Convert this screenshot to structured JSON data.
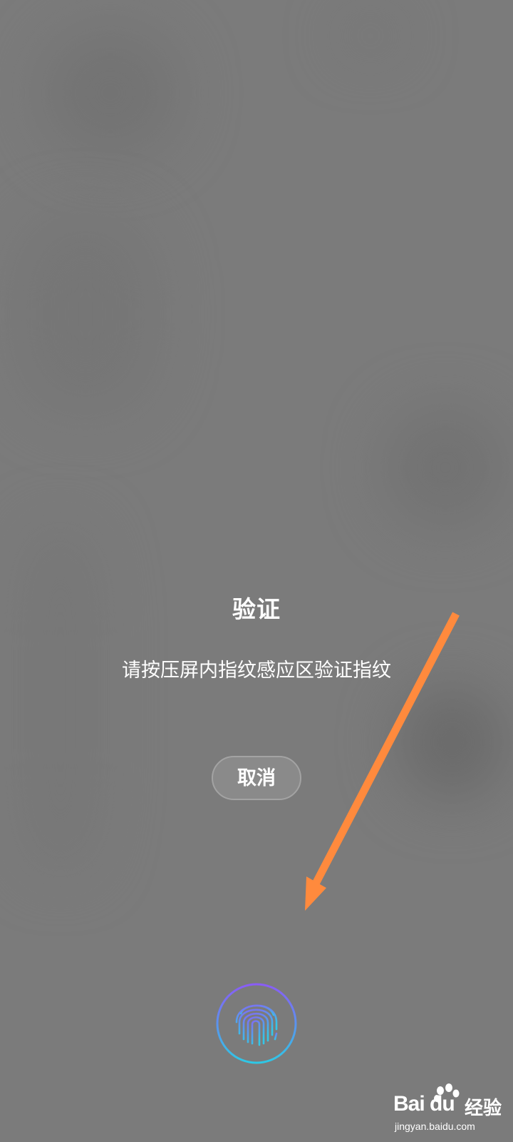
{
  "dialog": {
    "title": "验证",
    "message": "请按压屏内指纹感应区验证指纹",
    "cancel_label": "取消"
  },
  "annotation": {
    "arrow_color": "#ff8a3d"
  },
  "fingerprint": {
    "icon": "fingerprint-icon",
    "ring_colors": [
      "#8a5cf6",
      "#2ec8e6"
    ]
  },
  "watermark": {
    "logo_text": "Bai du",
    "brand_text": "经验",
    "url": "jingyan.baidu.com"
  },
  "colors": {
    "background": "#7b7b7b",
    "button_bg": "#8a8a8a",
    "text": "#ffffff"
  }
}
